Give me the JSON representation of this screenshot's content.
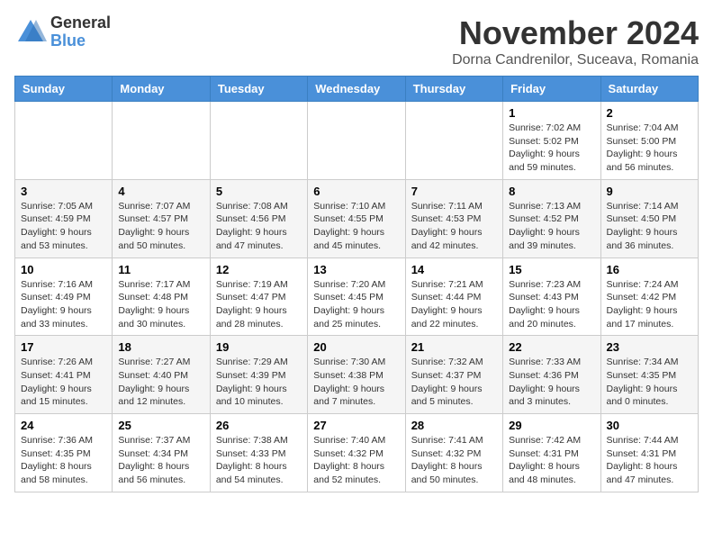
{
  "header": {
    "logo_general": "General",
    "logo_blue": "Blue",
    "month_year": "November 2024",
    "location": "Dorna Candrenilor, Suceava, Romania"
  },
  "weekdays": [
    "Sunday",
    "Monday",
    "Tuesday",
    "Wednesday",
    "Thursday",
    "Friday",
    "Saturday"
  ],
  "weeks": [
    [
      {
        "day": "",
        "info": ""
      },
      {
        "day": "",
        "info": ""
      },
      {
        "day": "",
        "info": ""
      },
      {
        "day": "",
        "info": ""
      },
      {
        "day": "",
        "info": ""
      },
      {
        "day": "1",
        "info": "Sunrise: 7:02 AM\nSunset: 5:02 PM\nDaylight: 9 hours and 59 minutes."
      },
      {
        "day": "2",
        "info": "Sunrise: 7:04 AM\nSunset: 5:00 PM\nDaylight: 9 hours and 56 minutes."
      }
    ],
    [
      {
        "day": "3",
        "info": "Sunrise: 7:05 AM\nSunset: 4:59 PM\nDaylight: 9 hours and 53 minutes."
      },
      {
        "day": "4",
        "info": "Sunrise: 7:07 AM\nSunset: 4:57 PM\nDaylight: 9 hours and 50 minutes."
      },
      {
        "day": "5",
        "info": "Sunrise: 7:08 AM\nSunset: 4:56 PM\nDaylight: 9 hours and 47 minutes."
      },
      {
        "day": "6",
        "info": "Sunrise: 7:10 AM\nSunset: 4:55 PM\nDaylight: 9 hours and 45 minutes."
      },
      {
        "day": "7",
        "info": "Sunrise: 7:11 AM\nSunset: 4:53 PM\nDaylight: 9 hours and 42 minutes."
      },
      {
        "day": "8",
        "info": "Sunrise: 7:13 AM\nSunset: 4:52 PM\nDaylight: 9 hours and 39 minutes."
      },
      {
        "day": "9",
        "info": "Sunrise: 7:14 AM\nSunset: 4:50 PM\nDaylight: 9 hours and 36 minutes."
      }
    ],
    [
      {
        "day": "10",
        "info": "Sunrise: 7:16 AM\nSunset: 4:49 PM\nDaylight: 9 hours and 33 minutes."
      },
      {
        "day": "11",
        "info": "Sunrise: 7:17 AM\nSunset: 4:48 PM\nDaylight: 9 hours and 30 minutes."
      },
      {
        "day": "12",
        "info": "Sunrise: 7:19 AM\nSunset: 4:47 PM\nDaylight: 9 hours and 28 minutes."
      },
      {
        "day": "13",
        "info": "Sunrise: 7:20 AM\nSunset: 4:45 PM\nDaylight: 9 hours and 25 minutes."
      },
      {
        "day": "14",
        "info": "Sunrise: 7:21 AM\nSunset: 4:44 PM\nDaylight: 9 hours and 22 minutes."
      },
      {
        "day": "15",
        "info": "Sunrise: 7:23 AM\nSunset: 4:43 PM\nDaylight: 9 hours and 20 minutes."
      },
      {
        "day": "16",
        "info": "Sunrise: 7:24 AM\nSunset: 4:42 PM\nDaylight: 9 hours and 17 minutes."
      }
    ],
    [
      {
        "day": "17",
        "info": "Sunrise: 7:26 AM\nSunset: 4:41 PM\nDaylight: 9 hours and 15 minutes."
      },
      {
        "day": "18",
        "info": "Sunrise: 7:27 AM\nSunset: 4:40 PM\nDaylight: 9 hours and 12 minutes."
      },
      {
        "day": "19",
        "info": "Sunrise: 7:29 AM\nSunset: 4:39 PM\nDaylight: 9 hours and 10 minutes."
      },
      {
        "day": "20",
        "info": "Sunrise: 7:30 AM\nSunset: 4:38 PM\nDaylight: 9 hours and 7 minutes."
      },
      {
        "day": "21",
        "info": "Sunrise: 7:32 AM\nSunset: 4:37 PM\nDaylight: 9 hours and 5 minutes."
      },
      {
        "day": "22",
        "info": "Sunrise: 7:33 AM\nSunset: 4:36 PM\nDaylight: 9 hours and 3 minutes."
      },
      {
        "day": "23",
        "info": "Sunrise: 7:34 AM\nSunset: 4:35 PM\nDaylight: 9 hours and 0 minutes."
      }
    ],
    [
      {
        "day": "24",
        "info": "Sunrise: 7:36 AM\nSunset: 4:35 PM\nDaylight: 8 hours and 58 minutes."
      },
      {
        "day": "25",
        "info": "Sunrise: 7:37 AM\nSunset: 4:34 PM\nDaylight: 8 hours and 56 minutes."
      },
      {
        "day": "26",
        "info": "Sunrise: 7:38 AM\nSunset: 4:33 PM\nDaylight: 8 hours and 54 minutes."
      },
      {
        "day": "27",
        "info": "Sunrise: 7:40 AM\nSunset: 4:32 PM\nDaylight: 8 hours and 52 minutes."
      },
      {
        "day": "28",
        "info": "Sunrise: 7:41 AM\nSunset: 4:32 PM\nDaylight: 8 hours and 50 minutes."
      },
      {
        "day": "29",
        "info": "Sunrise: 7:42 AM\nSunset: 4:31 PM\nDaylight: 8 hours and 48 minutes."
      },
      {
        "day": "30",
        "info": "Sunrise: 7:44 AM\nSunset: 4:31 PM\nDaylight: 8 hours and 47 minutes."
      }
    ]
  ]
}
